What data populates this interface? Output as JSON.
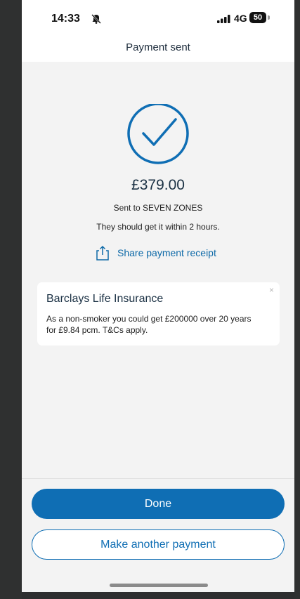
{
  "status_bar": {
    "time": "14:33",
    "network": "4G",
    "battery": "50",
    "icons": [
      "bell-muted-icon",
      "signal-icon",
      "battery-icon"
    ]
  },
  "header": {
    "title": "Payment sent"
  },
  "confirmation": {
    "icon": "checkmark-circle-icon",
    "amount": "£379.00",
    "recipient_text": "Sent to SEVEN ZONES",
    "eta_text": "They should get it within 2 hours.",
    "share_icon": "share-icon",
    "share_label": "Share payment receipt"
  },
  "promo": {
    "title": "Barclays Life Insurance",
    "body": "As a non-smoker you could get £200000 over 20 years for £9.84 pcm. T&Cs apply.",
    "close_label": "×"
  },
  "actions": {
    "done_label": "Done",
    "another_label": "Make another payment"
  },
  "colors": {
    "accent": "#0f6eb4",
    "background": "#f3f3f3"
  }
}
